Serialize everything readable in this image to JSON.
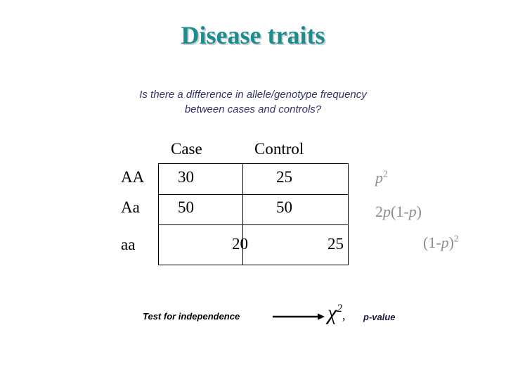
{
  "slide": {
    "title": "Disease traits",
    "title_color": "#1C8C8C",
    "subtitle_line1": "Is there a difference in allele/genotype frequency",
    "subtitle_line2": "between cases and controls?",
    "subtitle_color": "#33336B",
    "background_color": "#FFFFFF"
  },
  "table": {
    "column_headers": [
      "Case",
      "Control"
    ],
    "row_headers": [
      "AA",
      "Aa",
      "aa"
    ],
    "rows": [
      {
        "genotype": "AA",
        "case": "30",
        "control": "25"
      },
      {
        "genotype": "Aa",
        "case": "50",
        "control": "50"
      },
      {
        "genotype": "aa",
        "case": "20",
        "control": "25"
      }
    ],
    "border_color": "#000000",
    "text_color": "#000000"
  },
  "hwe_formulas": {
    "color": "#8C8C8C",
    "items": [
      {
        "base": "p",
        "exponent": "2",
        "prefix": "",
        "suffix": ""
      },
      {
        "text": "2p(1-p)"
      },
      {
        "text": "(1-p)",
        "exponent": "2"
      }
    ],
    "labels": [
      "p2",
      "2p(1-p)",
      "(1-p)2"
    ]
  },
  "footer": {
    "test_label": "Test for independence",
    "arrow_icon": "right-arrow-icon",
    "statistic_symbol": "χ",
    "statistic_exponent": "2",
    "separator": ",",
    "pvalue_label": "p-value",
    "pvalue_color": "#1B1B3A"
  }
}
